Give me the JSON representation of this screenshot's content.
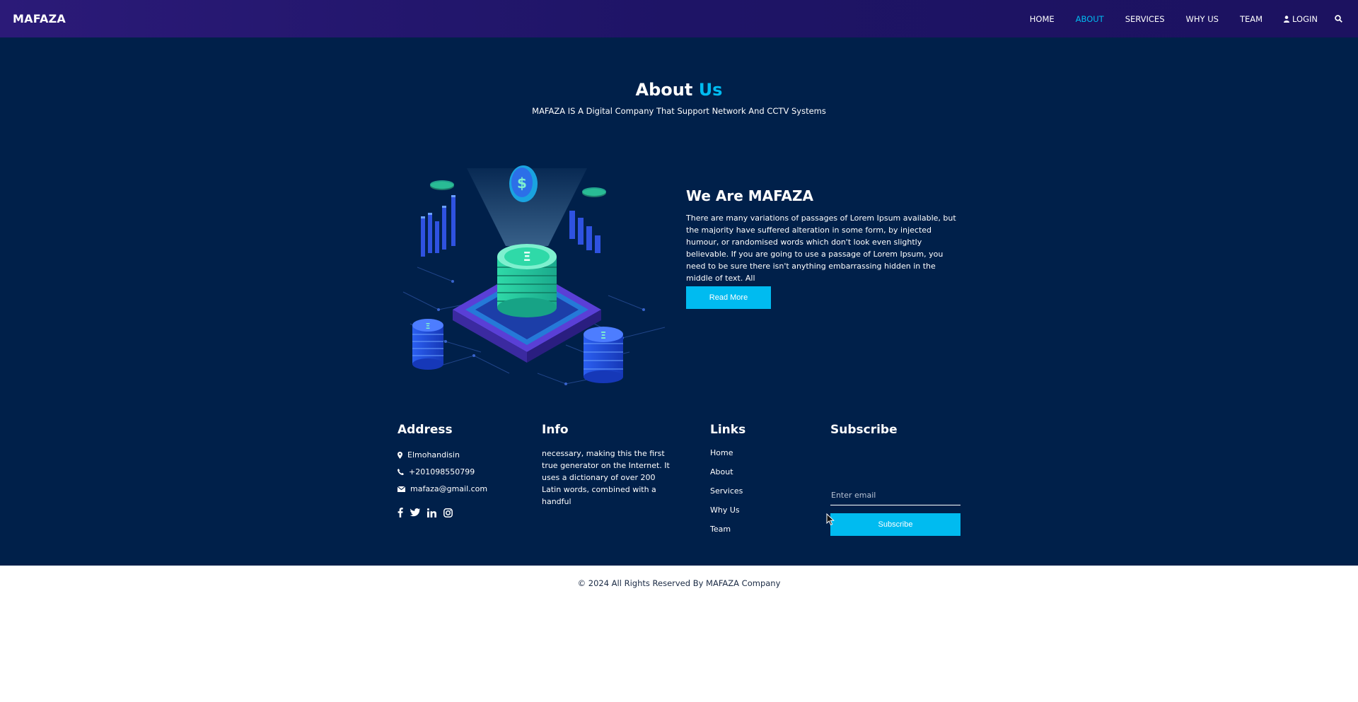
{
  "header": {
    "brand": "MAFAZA",
    "nav": [
      {
        "label": "HOME"
      },
      {
        "label": "ABOUT",
        "active": true
      },
      {
        "label": "SERVICES"
      },
      {
        "label": "WHY US"
      },
      {
        "label": "TEAM"
      },
      {
        "label": "LOGIN",
        "icon": "user-icon"
      }
    ],
    "search_icon": "search-icon"
  },
  "about": {
    "title_main": "About",
    "title_accent": "Us",
    "subtitle": "MAFAZA IS A Digital Company That Support Network And CCTV Systems",
    "heading": "We Are MAFAZA",
    "body": "There are many variations of passages of Lorem Ipsum available, but the majority have suffered alteration in some form, by injected humour, or randomised words which don't look even slightly believable. If you are going to use a passage of Lorem Ipsum, you need to be sure there isn't anything embarrassing hidden in the middle of text. All",
    "button": "Read More"
  },
  "footer": {
    "address": {
      "title": "Address",
      "location": "Elmohandisin",
      "phone": "+201098550799",
      "email": "mafaza@gmail.com",
      "socials": [
        "facebook-icon",
        "twitter-icon",
        "linkedin-icon",
        "instagram-icon"
      ]
    },
    "info": {
      "title": "Info",
      "text": "necessary, making this the first true generator on the Internet. It uses a dictionary of over 200 Latin words, combined with a handful"
    },
    "links": {
      "title": "Links",
      "items": [
        "Home",
        "About",
        "Services",
        "Why Us",
        "Team"
      ]
    },
    "subscribe": {
      "title": "Subscribe",
      "placeholder": "Enter email",
      "value": "",
      "button": "Subscribe"
    }
  },
  "copyright": "© 2024 All Rights Reserved By MAFAZA Company",
  "colors": {
    "header": "#1e1466",
    "main_bg": "#00204a",
    "accent": "#00bbf0"
  }
}
